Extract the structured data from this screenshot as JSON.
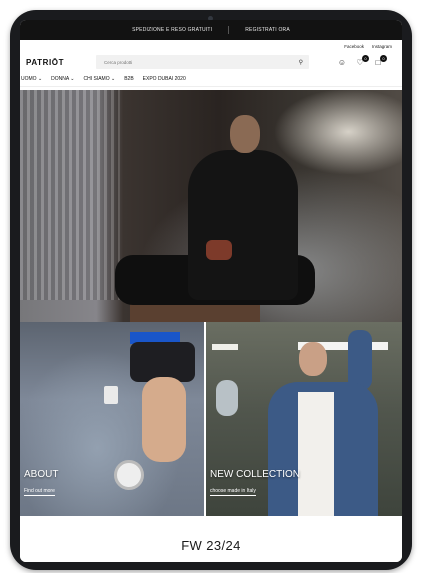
{
  "promo_bar": {
    "shipping": "SPEDIZIONE E RESO GRATUITI",
    "register": "REGISTRATI ORA"
  },
  "social": {
    "facebook": "Facebook",
    "instagram": "Instagram"
  },
  "header": {
    "logo": "PATRIŌT",
    "search_placeholder": "Cerca prodotti",
    "wishlist_count": "0",
    "cart_count": "0"
  },
  "nav": {
    "items": [
      {
        "label": "UOMO ⌄"
      },
      {
        "label": "DONNA ⌄"
      },
      {
        "label": "CHI SIAMO ⌄"
      },
      {
        "label": "B2B"
      },
      {
        "label": "EXPO DUBAI 2020"
      }
    ]
  },
  "tiles": {
    "about": {
      "title": "ABOUT",
      "link": "Find out more"
    },
    "collection": {
      "title": "NEW COLLECTION",
      "link": "choose made in Italy"
    }
  },
  "banner": {
    "text": "FW 23/24"
  },
  "icons": {
    "search": "search-icon",
    "account": "user-icon",
    "wishlist": "heart-icon",
    "cart": "bag-icon"
  }
}
